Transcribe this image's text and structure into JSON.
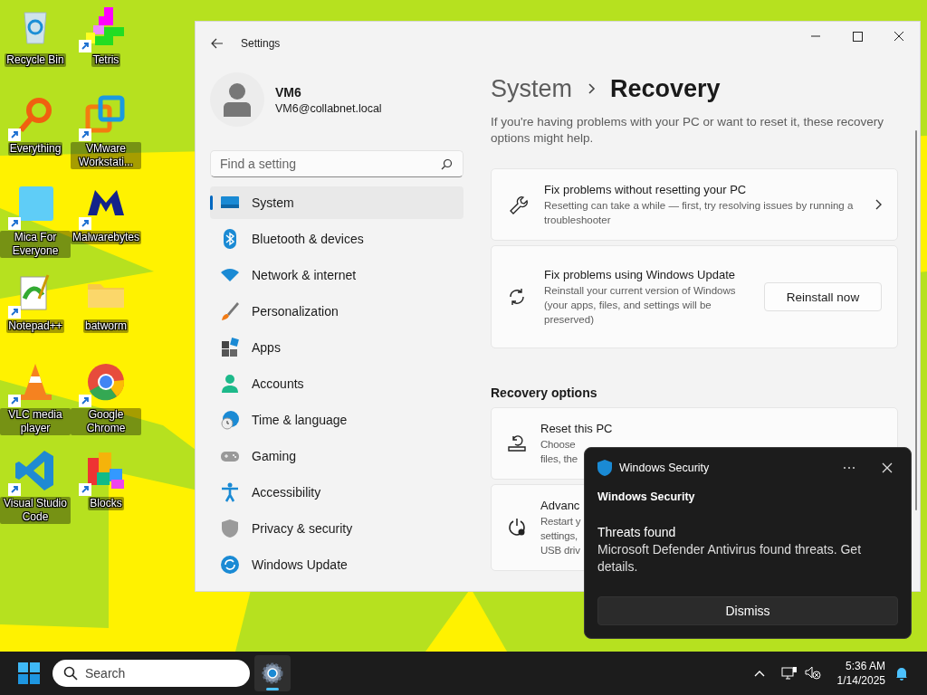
{
  "desktop_icons": [
    {
      "label": "Recycle Bin",
      "shortcut": false
    },
    {
      "label": "Tetris",
      "shortcut": true
    },
    {
      "label": "Everything",
      "shortcut": true
    },
    {
      "label": "VMware Workstati...",
      "shortcut": true
    },
    {
      "label": "Mica For Everyone",
      "shortcut": true
    },
    {
      "label": "Malwarebytes",
      "shortcut": true
    },
    {
      "label": "Notepad++",
      "shortcut": true
    },
    {
      "label": "batworm",
      "shortcut": false
    },
    {
      "label": "VLC media player",
      "shortcut": true
    },
    {
      "label": "Google Chrome",
      "shortcut": true
    },
    {
      "label": "Visual Studio Code",
      "shortcut": true
    },
    {
      "label": "Blocks",
      "shortcut": true
    }
  ],
  "settings": {
    "title": "Settings",
    "user": {
      "name": "VM6",
      "email": "VM6@collabnet.local"
    },
    "search": {
      "placeholder": "Find a setting"
    },
    "nav": [
      {
        "label": "System",
        "selected": true
      },
      {
        "label": "Bluetooth & devices",
        "selected": false
      },
      {
        "label": "Network & internet",
        "selected": false
      },
      {
        "label": "Personalization",
        "selected": false
      },
      {
        "label": "Apps",
        "selected": false
      },
      {
        "label": "Accounts",
        "selected": false
      },
      {
        "label": "Time & language",
        "selected": false
      },
      {
        "label": "Gaming",
        "selected": false
      },
      {
        "label": "Accessibility",
        "selected": false
      },
      {
        "label": "Privacy & security",
        "selected": false
      },
      {
        "label": "Windows Update",
        "selected": false
      }
    ],
    "breadcrumb": {
      "parent": "System",
      "current": "Recovery"
    },
    "intro": "If you're having problems with your PC or want to reset it, these recovery options might help.",
    "cards": [
      {
        "kind": "link",
        "title": "Fix problems without resetting your PC",
        "description": "Resetting can take a while — first, try resolving issues by running a troubleshooter"
      },
      {
        "kind": "button",
        "title": "Fix problems using Windows Update",
        "description": "Reinstall your current version of Windows (your apps, files, and settings will be preserved)",
        "button": "Reinstall now"
      }
    ],
    "section_title": "Recovery options",
    "options": [
      {
        "title": "Reset this PC",
        "lines": [
          "Choose",
          "files, the"
        ]
      },
      {
        "title": "Advanc",
        "lines": [
          "Restart y",
          "settings,",
          "USB driv"
        ]
      }
    ]
  },
  "toast": {
    "app": "Windows Security",
    "source": "Windows Security",
    "heading": "Threats found",
    "body": "Microsoft Defender Antivirus found threats. Get details.",
    "button": "Dismiss"
  },
  "taskbar": {
    "search": {
      "placeholder": "Search"
    },
    "apps": [
      {
        "running": true
      }
    ],
    "time": "5:36 AM",
    "date": "1/14/2025"
  }
}
